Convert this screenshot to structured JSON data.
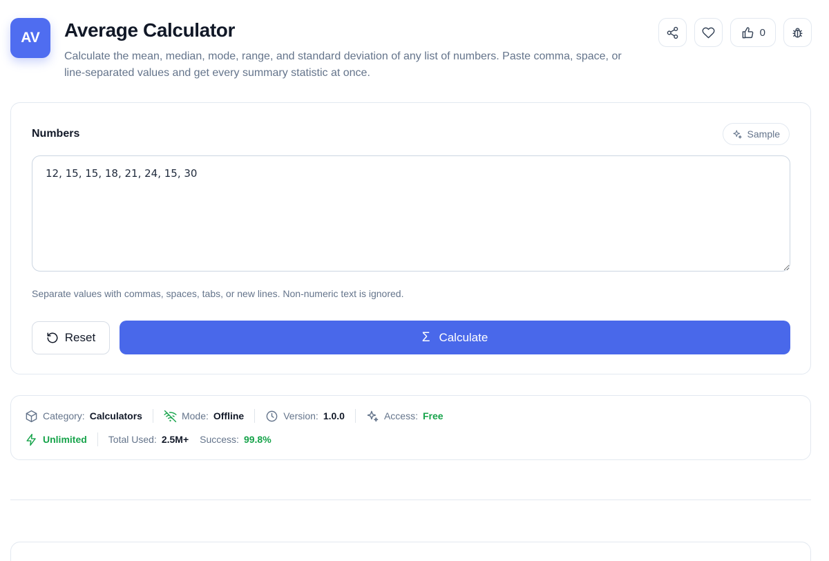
{
  "header": {
    "logo_text": "AV",
    "title": "Average Calculator",
    "subtitle": "Calculate the mean, median, mode, range, and standard deviation of any list of numbers. Paste comma, space, or line-separated values and get every summary statistic at once.",
    "like_count": "0",
    "icons": [
      "share-icon",
      "heart-icon",
      "thumbs-up-icon",
      "bug-icon"
    ]
  },
  "input": {
    "label": "Numbers",
    "sample_label": "Sample",
    "value": "12, 15, 15, 18, 21, 24, 15, 30",
    "hint": "Separate values with commas, spaces, tabs, or new lines. Non-numeric text is ignored."
  },
  "actions": {
    "reset_label": "Reset",
    "calculate_label": "Calculate",
    "calculate_symbol": "Σ"
  },
  "meta": {
    "category_label": "Category:",
    "category_value": "Calculators",
    "mode_label": "Mode:",
    "mode_value": "Offline",
    "version_label": "Version:",
    "version_value": "1.0.0",
    "access_label": "Access:",
    "access_value": "Free",
    "unlimited_label": "Unlimited",
    "total_label": "Total Used:",
    "total_value": "2.5M+",
    "success_label": "Success:",
    "success_value": "99.8%"
  },
  "colors": {
    "primary": "#4968ea",
    "success": "#16a34a",
    "muted": "#64748b"
  }
}
